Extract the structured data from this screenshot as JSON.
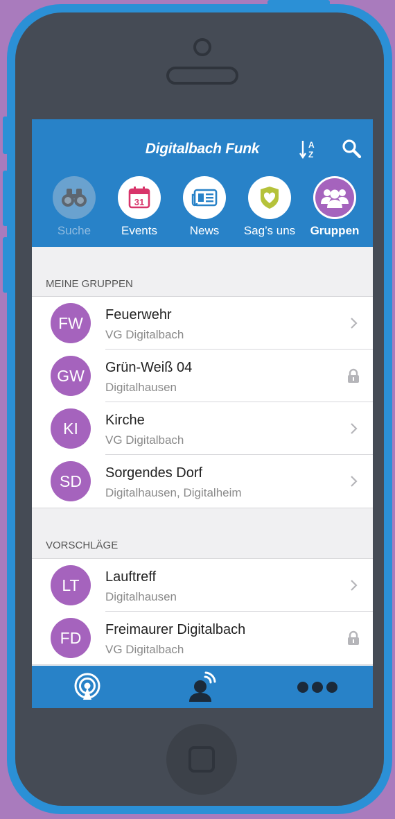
{
  "app": {
    "title": "Digitalbach Funk"
  },
  "top_nav": [
    {
      "key": "suche",
      "label": "Suche",
      "icon": "binoculars-icon",
      "state": "muted"
    },
    {
      "key": "events",
      "label": "Events",
      "icon": "calendar-icon",
      "calendar_day": "31",
      "state": "normal"
    },
    {
      "key": "news",
      "label": "News",
      "icon": "newspaper-icon",
      "state": "normal"
    },
    {
      "key": "sagsuns",
      "label": "Sag’s uns",
      "icon": "shield-heart-icon",
      "state": "normal"
    },
    {
      "key": "gruppen",
      "label": "Gruppen",
      "icon": "group-icon",
      "state": "active"
    }
  ],
  "sections": [
    {
      "label": "MEINE GRUPPEN",
      "items": [
        {
          "initials": "FW",
          "title": "Feuerwehr",
          "subtitle": "VG Digitalbach",
          "accessory": "chevron"
        },
        {
          "initials": "GW",
          "title": "Grün-Weiß 04",
          "subtitle": "Digitalhausen",
          "accessory": "lock"
        },
        {
          "initials": "KI",
          "title": "Kirche",
          "subtitle": "VG Digitalbach",
          "accessory": "chevron"
        },
        {
          "initials": "SD",
          "title": "Sorgendes Dorf",
          "subtitle": "Digitalhausen, Digitalheim",
          "accessory": "chevron"
        }
      ]
    },
    {
      "label": "VORSCHLÄGE",
      "items": [
        {
          "initials": "LT",
          "title": "Lauftreff",
          "subtitle": "Digitalhausen",
          "accessory": "chevron"
        },
        {
          "initials": "FD",
          "title": "Freimaurer Digitalbach",
          "subtitle": "VG Digitalbach",
          "accessory": "lock"
        }
      ]
    }
  ],
  "tabbar": [
    {
      "icon": "broadcast-icon"
    },
    {
      "icon": "speaker-person-icon"
    },
    {
      "icon": "more-icon"
    }
  ],
  "colors": {
    "background": "#a97bbd",
    "phone_frame": "#2b90d6",
    "header": "#2882c8",
    "accent_purple": "#a563bd"
  }
}
